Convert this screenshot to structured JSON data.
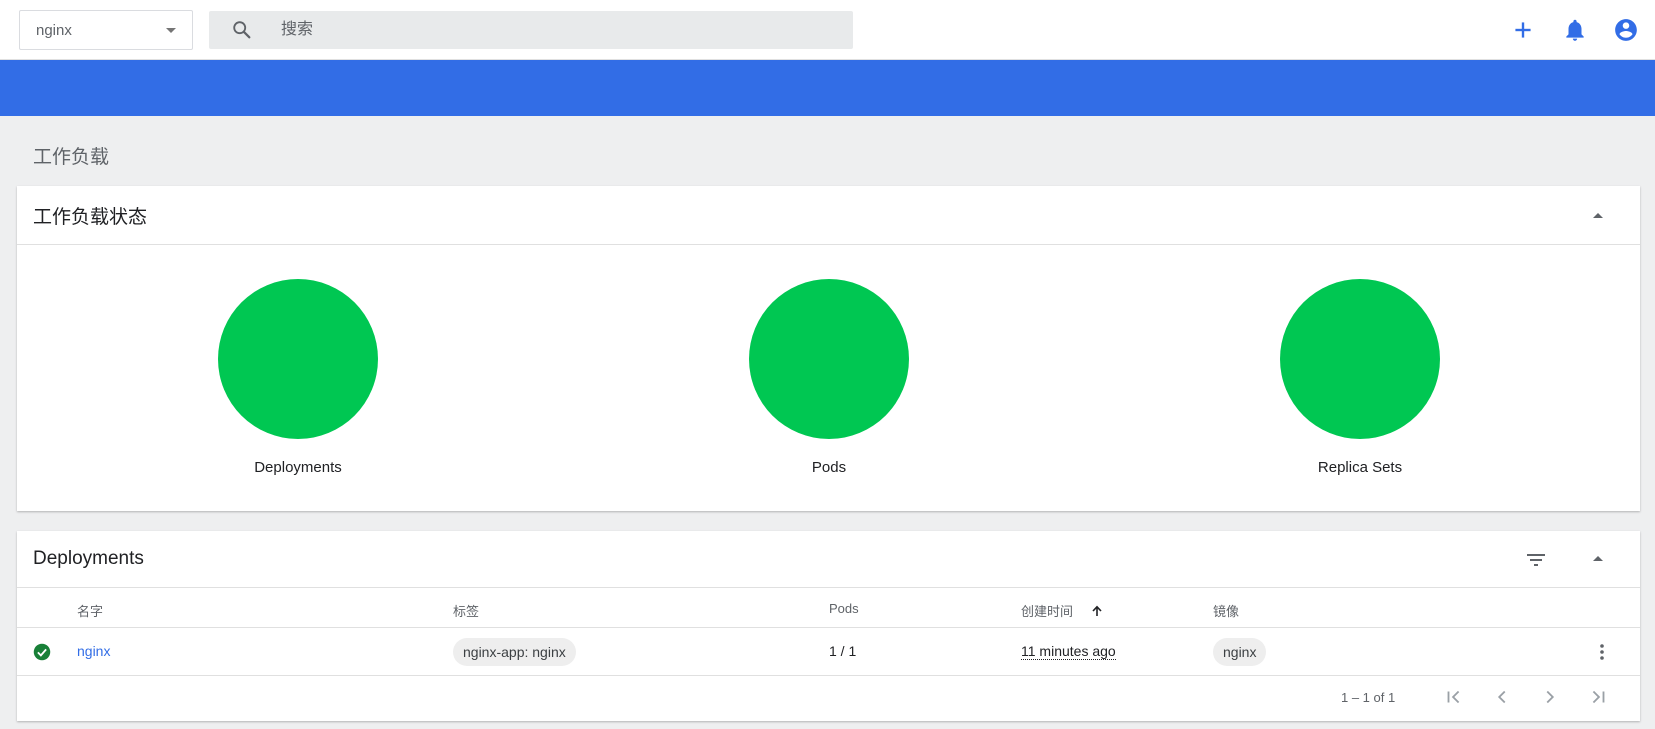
{
  "header": {
    "namespace": "nginx",
    "search_placeholder": "搜索"
  },
  "colors": {
    "accent": "#326de6",
    "success": "#00c752",
    "success_icon": "#188038"
  },
  "page": {
    "title": "工作负载"
  },
  "workload_status": {
    "title": "工作负载状态",
    "items": [
      {
        "label": "Deployments",
        "status": "running"
      },
      {
        "label": "Pods",
        "status": "running"
      },
      {
        "label": "Replica Sets",
        "status": "running"
      }
    ]
  },
  "deployments": {
    "title": "Deployments",
    "columns": {
      "name": "名字",
      "labels": "标签",
      "pods": "Pods",
      "created": "创建时间",
      "images": "镜像"
    },
    "rows": [
      {
        "name": "nginx",
        "label": "nginx-app: nginx",
        "pods": "1 / 1",
        "created": "11 minutes ago",
        "image": "nginx"
      }
    ],
    "paginator": {
      "range": "1 – 1 of 1"
    }
  }
}
